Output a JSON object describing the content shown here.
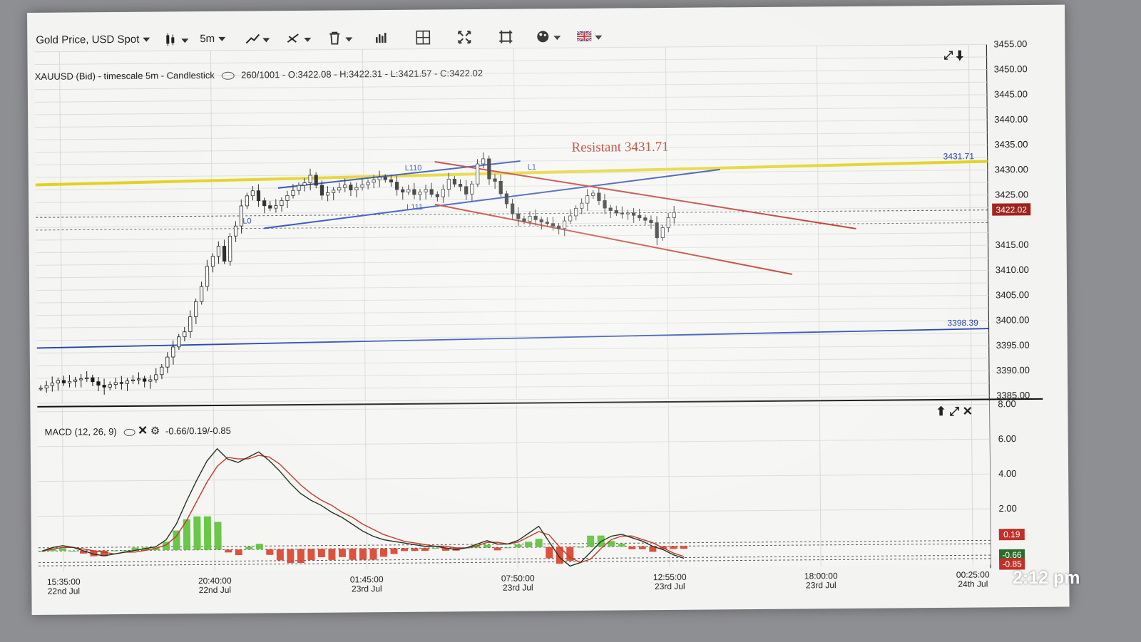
{
  "toolbar": {
    "symbol": "Gold Price, USD Spot",
    "timeframe": "5m"
  },
  "main_legend": "XAUUSD (Bid) - timescale 5m - Candlestick",
  "ohlc": "260/1001 - O:3422.08 - H:3422.31 - L:3421.57 - C:3422.02",
  "macd_legend": "MACD (12, 26, 9)",
  "macd_values": "-0.66/0.19/-0.85",
  "clock": "2:12 pm",
  "colors": {
    "yellow": "#e2d21c",
    "blue": "#1f3fb0",
    "red": "#b52a1c",
    "macd": "#223322",
    "signal": "#c33a2a",
    "hist_pos": "#5bc236",
    "hist_neg": "#d8402a",
    "price_tag": "#a0211c"
  },
  "chart_data": [
    {
      "type": "candlestick",
      "ylim": [
        3385,
        3455
      ],
      "y_ticks": [
        "3455.00",
        "3450.00",
        "3445.00",
        "3440.00",
        "3435.00",
        "3430.00",
        "3425.00",
        "3422.02",
        "3415.00",
        "3410.00",
        "3405.00",
        "3400.00",
        "3395.00",
        "3390.00",
        "3385.00"
      ],
      "x_ticks": [
        {
          "time": "15:35:00",
          "date": "22nd Jul"
        },
        {
          "time": "20:40:00",
          "date": "22nd Jul"
        },
        {
          "time": "01:45:00",
          "date": "23rd Jul"
        },
        {
          "time": "07:50:00",
          "date": "23rd Jul"
        },
        {
          "time": "12:55:00",
          "date": "23rd Jul"
        },
        {
          "time": "18:00:00",
          "date": "23rd Jul"
        },
        {
          "time": "00:25:00",
          "date": "24th Jul"
        }
      ],
      "last_price": 3422.02,
      "price_series": [
        3388,
        3388.5,
        3389,
        3389.5,
        3389,
        3389.3,
        3389.6,
        3389.8,
        3390,
        3389.2,
        3388.5,
        3388.1,
        3388.6,
        3389,
        3388.8,
        3389.3,
        3389.5,
        3389.7,
        3389.2,
        3389.5,
        3390.5,
        3392,
        3394,
        3396,
        3398,
        3399,
        3402,
        3405,
        3408,
        3412,
        3414,
        3416,
        3413,
        3418,
        3420,
        3424,
        3426,
        3427,
        3425,
        3424,
        3423.5,
        3424,
        3425,
        3426,
        3427,
        3428,
        3428.5,
        3430,
        3428,
        3426,
        3426.5,
        3427,
        3427.5,
        3428,
        3427,
        3427.5,
        3428,
        3428.5,
        3429,
        3429.5,
        3429,
        3428.5,
        3427,
        3426.5,
        3427,
        3426,
        3426.5,
        3427,
        3426,
        3425.5,
        3427,
        3429,
        3428,
        3427.5,
        3426,
        3428,
        3432,
        3433,
        3429,
        3428.5,
        3426,
        3424,
        3422,
        3421,
        3420.5,
        3421.5,
        3420.8,
        3420.3,
        3420,
        3419.5,
        3419,
        3420.5,
        3421.5,
        3423,
        3424,
        3425.5,
        3426,
        3424.5,
        3423,
        3422.5,
        3422,
        3421.8,
        3422,
        3421.5,
        3421,
        3420.5,
        3420,
        3417,
        3419,
        3421,
        3422.02
      ],
      "annotations": [
        {
          "label": "Resistant 3431.71",
          "color": "red"
        },
        {
          "label": "3431.71",
          "color": "blue"
        },
        {
          "label": "3398.39",
          "color": "blue"
        },
        {
          "label": "L110"
        },
        {
          "label": "L111"
        },
        {
          "label": "L1"
        },
        {
          "label": "L0"
        }
      ],
      "lines": [
        {
          "name": "resistance-horizontal",
          "color": "yellow",
          "y": [
            3428.5,
            3431.71
          ]
        },
        {
          "name": "support-horizontal",
          "color": "blue",
          "y": [
            3396,
            3398.39
          ]
        }
      ]
    },
    {
      "type": "line",
      "title": "MACD (12, 26, 9)",
      "ylim": [
        -1,
        8
      ],
      "y_ticks": [
        "8.00",
        "6.00",
        "4.00",
        "2.00"
      ],
      "value_labels": [
        "0.19",
        "-0.66",
        "-0.85"
      ],
      "macd": [
        0,
        0.2,
        0.3,
        0.2,
        0,
        -0.2,
        -0.3,
        -0.2,
        -0.1,
        0,
        0.1,
        0.2,
        0.6,
        1.5,
        2.8,
        4,
        5.1,
        5.8,
        5.2,
        5,
        5.3,
        5.6,
        5.1,
        4.5,
        3.8,
        3.2,
        2.8,
        2.5,
        2.1,
        1.8,
        1.4,
        1,
        0.7,
        0.5,
        0.4,
        0.3,
        0.2,
        0.1,
        0.1,
        0,
        -0.1,
        0,
        0.2,
        0.4,
        0.2,
        0.2,
        0.4,
        0.8,
        1.2,
        0.3,
        -0.6,
        -1.1,
        -0.9,
        -0.3,
        0.3,
        0.6,
        0.7,
        0.5,
        0.3,
        0,
        -0.2,
        -0.5,
        -0.7
      ],
      "signal": [
        0,
        0.1,
        0.2,
        0.2,
        0.1,
        0,
        -0.1,
        -0.2,
        -0.1,
        -0.1,
        0,
        0.1,
        0.3,
        0.8,
        1.7,
        2.8,
        3.9,
        4.8,
        5.3,
        5.2,
        5.2,
        5.4,
        5.3,
        4.9,
        4.3,
        3.7,
        3.2,
        2.8,
        2.5,
        2.1,
        1.8,
        1.4,
        1.1,
        0.8,
        0.6,
        0.4,
        0.3,
        0.2,
        0.1,
        0.1,
        0,
        0,
        0.1,
        0.3,
        0.3,
        0.2,
        0.3,
        0.6,
        0.9,
        0.7,
        0,
        -0.6,
        -0.9,
        -0.7,
        -0.1,
        0.4,
        0.6,
        0.6,
        0.4,
        0.2,
        -0.1,
        -0.4,
        -0.6
      ]
    }
  ]
}
